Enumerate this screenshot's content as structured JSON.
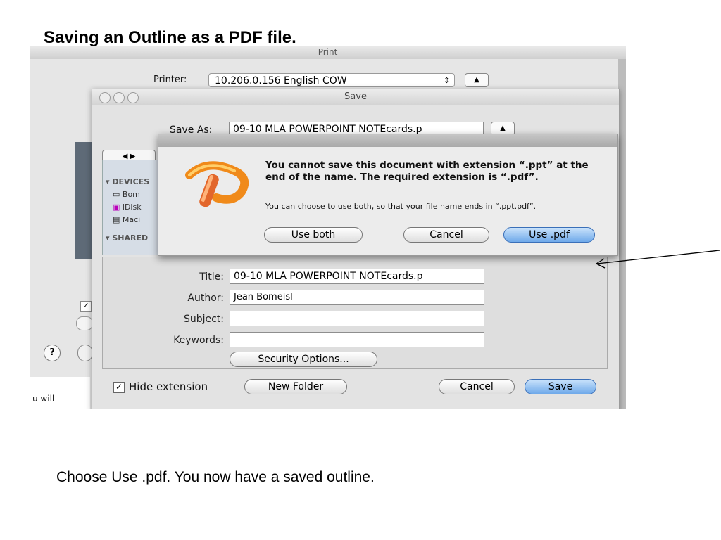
{
  "slide": {
    "title": "Saving an Outline as a PDF file.",
    "caption": "Choose Use .pdf.  You now have a saved outline."
  },
  "print_dialog": {
    "title": "Print",
    "printer_label": "Printer:",
    "printer_value": "10.206.0.156 English COW",
    "side_text": "u will"
  },
  "save_dialog": {
    "title": "Save",
    "save_as_label": "Save As:",
    "save_as_value": "09-10 MLA POWERPOINT NOTEcards.p",
    "sidebar": {
      "devices_header": "DEVICES",
      "devices": [
        "Bom",
        "iDisk",
        "Maci"
      ],
      "shared_header": "SHARED"
    },
    "fields": {
      "title_label": "Title:",
      "title_value": "09-10 MLA POWERPOINT NOTEcards.p",
      "author_label": "Author:",
      "author_value": "Jean Bomeisl",
      "subject_label": "Subject:",
      "subject_value": "",
      "keywords_label": "Keywords:",
      "keywords_value": ""
    },
    "security_button": "Security Options...",
    "hide_extension_label": "Hide extension",
    "hide_extension_checked": true,
    "new_folder_button": "New Folder",
    "cancel_button": "Cancel",
    "save_button": "Save"
  },
  "alert": {
    "icon": "powerpoint-icon",
    "message": "You cannot save this document with extension “.ppt” at the end of the name. The required extension is “.pdf”.",
    "info": "You can choose to use both, so that your file name ends in “.ppt.pdf”.",
    "use_both_button": "Use both",
    "cancel_button": "Cancel",
    "use_pdf_button": "Use .pdf"
  }
}
